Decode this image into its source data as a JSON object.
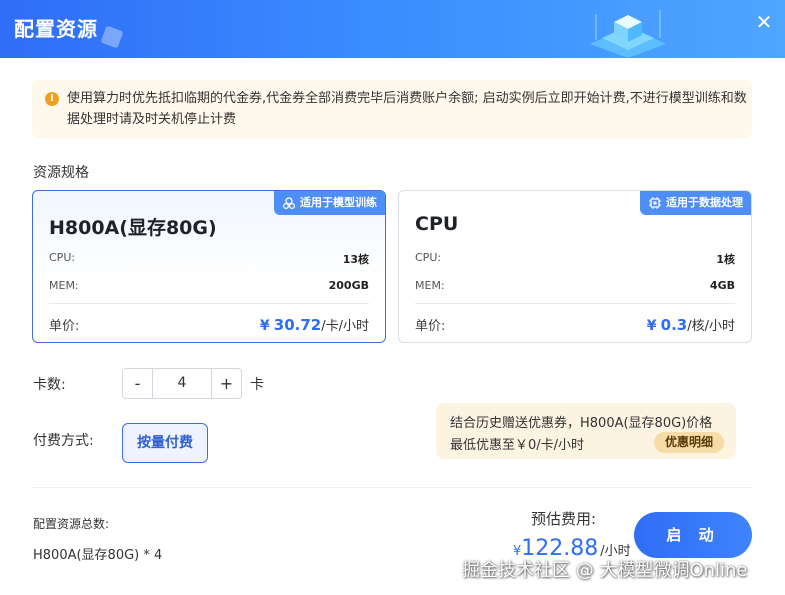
{
  "dialog": {
    "title": "配置资源",
    "close_label": "✕"
  },
  "notice": {
    "text": "使用算力时优先抵扣临期的代金券,代金券全部消费完毕后消费账户余额; 启动实例后立即开始计费,不进行模型训练和数据处理时请及时关机停止计费"
  },
  "resource": {
    "section_label": "资源规格",
    "cards": [
      {
        "tag": "适用于模型训练",
        "tag_icon": "model-icon",
        "name": "H800A(显存80G)",
        "cpu_label": "CPU:",
        "cpu_value": "13核",
        "mem_label": "MEM:",
        "mem_value": "200GB",
        "price_label": "单价:",
        "price_currency": "¥",
        "price_amount": "30.72",
        "price_unit": "/卡/小时",
        "selected": true
      },
      {
        "tag": "适用于数据处理",
        "tag_icon": "chip-icon",
        "name": "CPU",
        "cpu_label": "CPU:",
        "cpu_value": "1核",
        "mem_label": "MEM:",
        "mem_value": "4GB",
        "price_label": "单价:",
        "price_currency": "¥",
        "price_amount": "0.3",
        "price_unit": "/核/小时",
        "selected": false
      }
    ]
  },
  "quantity": {
    "label": "卡数:",
    "minus": "-",
    "value": "4",
    "plus": "+",
    "unit": "卡"
  },
  "payment": {
    "label": "付费方式:",
    "option": "按量付费"
  },
  "promo": {
    "line1": "结合历史赠送优惠券，H800A(显存80G)价格",
    "line2": "最低优惠至￥0/卡/小时",
    "detail_button": "优惠明细"
  },
  "summary": {
    "label": "配置资源总数:",
    "value": "H800A(显存80G) * 4"
  },
  "estimate": {
    "label": "预估费用:",
    "currency": "¥",
    "amount": "122.88",
    "unit": "/小时"
  },
  "launch_button": "启 动",
  "watermark": "掘金技术社区 @ 大模型微调Online",
  "colors": {
    "accent": "#2f6df6",
    "tag": "#4f8ef7",
    "notice_bg": "#fff8ec",
    "promo_bg": "#fdf3e1"
  }
}
